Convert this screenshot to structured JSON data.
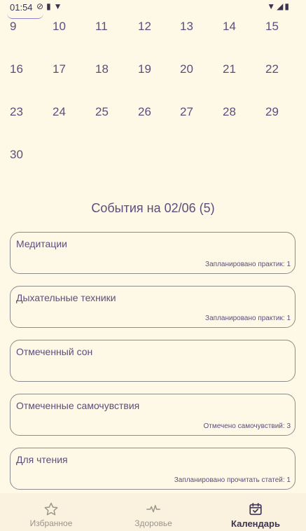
{
  "status": {
    "time": "01:54",
    "left_icons": [
      "dnd-icon",
      "sd-card-icon",
      "vpn-icon"
    ],
    "right_icons": [
      "wifi-icon",
      "signal-icon",
      "battery-icon"
    ]
  },
  "calendar": {
    "rows": [
      [
        "9",
        "10",
        "11",
        "12",
        "13",
        "14",
        "15"
      ],
      [
        "16",
        "17",
        "18",
        "19",
        "20",
        "21",
        "22"
      ],
      [
        "23",
        "24",
        "25",
        "26",
        "27",
        "28",
        "29"
      ],
      [
        "30"
      ]
    ]
  },
  "events": {
    "title": "События на 02/06  (5)",
    "items": [
      {
        "title": "Медитации",
        "count": "Запланировано практик: 1"
      },
      {
        "title": "Дыхательные техники",
        "count": "Запланировано практик: 1"
      },
      {
        "title": "Отмеченный сон",
        "count": ""
      },
      {
        "title": "Отмеченные самочувствия",
        "count": "Отмечено самочувствий: 3"
      },
      {
        "title": "Для чтения",
        "count": "Запланировано прочитать статей: 1"
      }
    ]
  },
  "nav": {
    "favorites": "Избранное",
    "health": "Здоровье",
    "calendar": "Календарь"
  },
  "colors": {
    "background": "#fdf9e6",
    "accent_text": "#5a4f7c",
    "card_border": "#8c8c8c",
    "nav_background": "#fbf1df"
  }
}
